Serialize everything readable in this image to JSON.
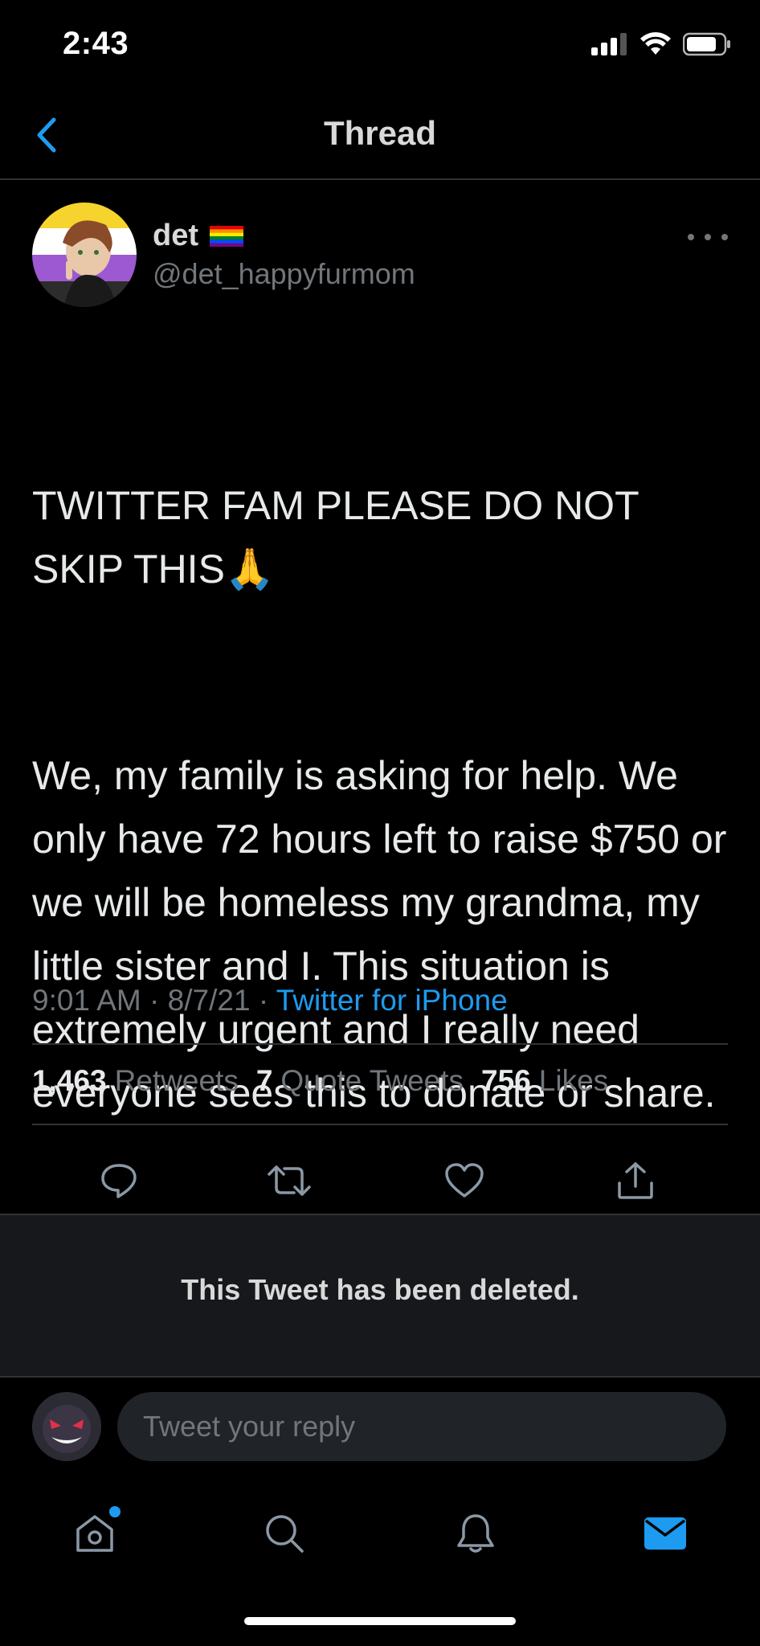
{
  "status_bar": {
    "time": "2:43"
  },
  "nav": {
    "title": "Thread"
  },
  "tweet": {
    "author": {
      "name": "det",
      "name_emoji": "🏳️‍🌈",
      "handle": "@det_happyfurmom"
    },
    "text_paragraphs": [
      "TWITTER FAM PLEASE DO NOT SKIP THIS🙏",
      "We, my family is asking for help. We only have 72 hours left to raise $750 or we will be homeless my grandma, my little sister and I. This situation is extremely urgent and I really need everyone sees this to donate or share."
    ],
    "meta": {
      "time": "9:01 AM",
      "date": "8/7/21",
      "separator": "·",
      "source": "Twitter for iPhone"
    },
    "stats": {
      "retweets_count": "1,463",
      "retweets_label": "Retweets",
      "quotes_count": "7",
      "quotes_label": "Quote Tweets",
      "likes_count": "756",
      "likes_label": "Likes"
    },
    "actions": [
      "reply-icon",
      "retweet-icon",
      "like-icon",
      "share-icon"
    ]
  },
  "deleted_notice": {
    "text": "This Tweet has been deleted."
  },
  "reply": {
    "placeholder": "Tweet your reply"
  },
  "tab_bar": {
    "tabs": [
      "home-icon",
      "search-icon",
      "notifications-icon",
      "messages-icon"
    ],
    "active": "messages-icon"
  },
  "colors": {
    "accent": "#1d9bf0",
    "background": "#000000",
    "muted": "#71767b",
    "panel": "#16181c"
  }
}
